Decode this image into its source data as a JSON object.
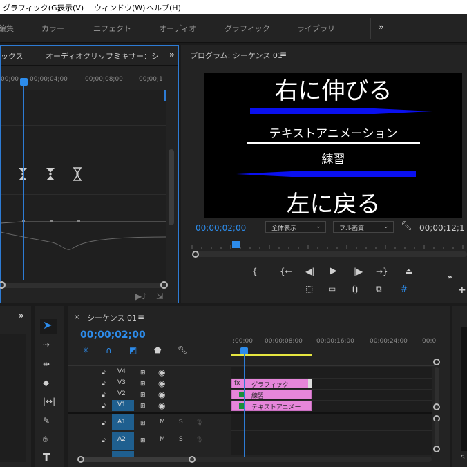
{
  "menu": [
    "グラフィック(G)",
    "表示(V)",
    "ウィンドウ(W)",
    "ヘルプ(H)"
  ],
  "workspaces": [
    "編集",
    "カラー",
    "エフェクト",
    "オーディオ",
    "グラフィック",
    "ライブラリ"
  ],
  "effect_controls": {
    "tab_partial": "ックス",
    "tab_mixer": "オーディオクリップミキサー：シ",
    "ruler": [
      "00;00",
      "00;00;04;00",
      "00;00;08;00",
      "00;00;1"
    ]
  },
  "program": {
    "title": "プログラム: シーケンス 01",
    "timecode": "00;00;02;00",
    "zoom": "全体表示",
    "quality": "フル画質",
    "duration": "00;00;12;1",
    "preview": {
      "top_text": "右に伸びる",
      "mid_text": "テキストアニメーション",
      "sub_text": "練習",
      "bottom_text": "左に戻る"
    },
    "colors": {
      "arrow": "#0a10f0"
    }
  },
  "sequence": {
    "title": "シーケンス 01",
    "timecode": "00;00;02;00",
    "ruler": [
      ";00;00",
      "00;00;08;00",
      "00;00;16;00",
      "00;00;24;00",
      "00;0"
    ],
    "tracks": {
      "video": [
        "V4",
        "V3",
        "V2",
        "V1"
      ],
      "audio": [
        "A1",
        "A2"
      ]
    },
    "clips": [
      {
        "label": "グラフィック",
        "track": "V3"
      },
      {
        "label": "練習",
        "track": "V2"
      },
      {
        "label": "テキストアニメー",
        "track": "V1"
      }
    ],
    "colors": {
      "clip": "#e686da",
      "tracktarget": "#1f5f8f"
    }
  },
  "mute_label": "M",
  "solo_label": "S"
}
